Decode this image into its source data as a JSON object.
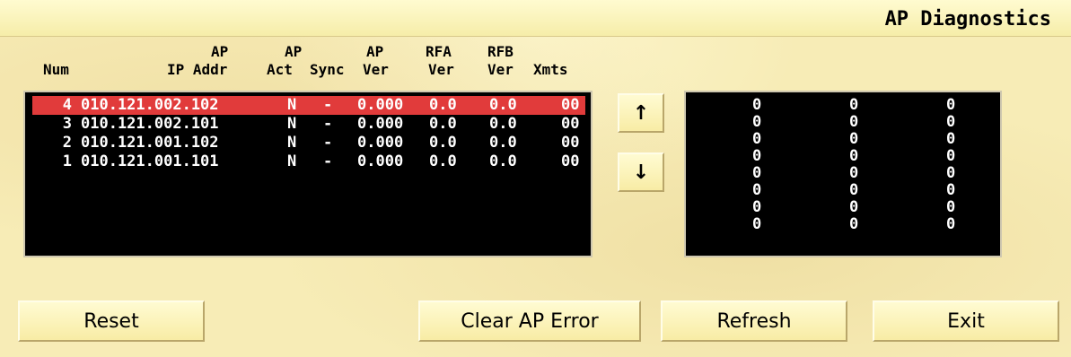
{
  "window": {
    "title": "AP Diagnostics"
  },
  "headers": {
    "num": "Num",
    "ip_top": "AP",
    "ip_bottom": "IP Addr",
    "act_top": "AP",
    "act_bottom": "Act",
    "sync_bottom": "Sync",
    "ver_top": "AP",
    "ver_bottom": "Ver",
    "rfa_top": "RFA",
    "rfa_bottom": "Ver",
    "rfb_top": "RFB",
    "rfb_bottom": "Ver",
    "xmts": "Xmts"
  },
  "rows": [
    {
      "num": "4",
      "ip": "010.121.002.102",
      "act": "N",
      "sync": "-",
      "apver": "0.000",
      "rfa": "0.0",
      "rfb": "0.0",
      "xmts": "00"
    },
    {
      "num": "3",
      "ip": "010.121.002.101",
      "act": "N",
      "sync": "-",
      "apver": "0.000",
      "rfa": "0.0",
      "rfb": "0.0",
      "xmts": "00"
    },
    {
      "num": "2",
      "ip": "010.121.001.102",
      "act": "N",
      "sync": "-",
      "apver": "0.000",
      "rfa": "0.0",
      "rfb": "0.0",
      "xmts": "00"
    },
    {
      "num": "1",
      "ip": "010.121.001.101",
      "act": "N",
      "sync": "-",
      "apver": "0.000",
      "rfa": "0.0",
      "rfb": "0.0",
      "xmts": "00"
    }
  ],
  "selected_row_num": "4",
  "counters": {
    "col1": [
      "0",
      "0",
      "0",
      "0",
      "0",
      "0",
      "0",
      "0"
    ],
    "col2": [
      "0",
      "0",
      "0",
      "0",
      "0",
      "0",
      "0",
      "0"
    ],
    "col3": [
      "0",
      "0",
      "0",
      "0",
      "0",
      "0",
      "0",
      "0"
    ]
  },
  "buttons": {
    "scroll_up": "↑",
    "scroll_down": "↓",
    "reset": "Reset",
    "clear_ap_error": "Clear AP Error",
    "refresh": "Refresh",
    "exit": "Exit"
  },
  "colors": {
    "background": "#f7ecb6",
    "panel": "#000000",
    "selection": "#e13b3b",
    "panel_text": "#ffffff"
  }
}
